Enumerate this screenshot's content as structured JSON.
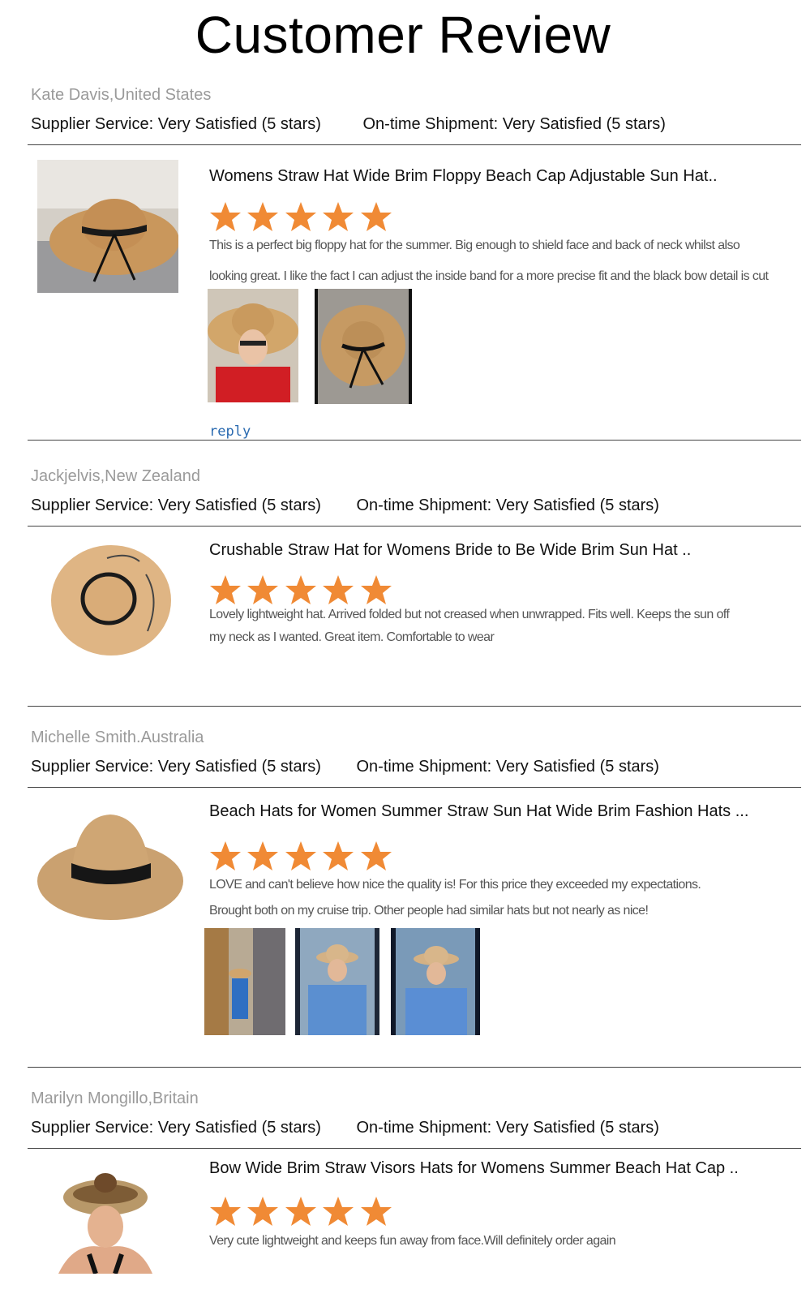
{
  "page": {
    "title": "Customer Review"
  },
  "colors": {
    "star": "#f08a35",
    "reviewer": "#9a9a9a",
    "link": "#2a6ab0"
  },
  "reviews": [
    {
      "reviewer": "Kate Davis,United States",
      "supplier_service": "Supplier Service: Very Satisfied (5 stars)",
      "shipment": "On-time Shipment: Very Satisfied (5 stars)",
      "product_title": "Womens Straw Hat Wide Brim Floppy Beach Cap Adjustable Sun Hat..",
      "rating": 5,
      "text": [
        "This is a perfect big floppy hat for the summer. Big enough to shield face and back of neck whilst also",
        "looking great. I like the fact I can adjust the inside band for a more precise fit and the black bow detail is cut"
      ],
      "reply_label": "reply"
    },
    {
      "reviewer": "Jackjelvis,New Zealand",
      "supplier_service": "Supplier Service: Very Satisfied (5 stars)",
      "shipment": "On-time Shipment: Very Satisfied (5 stars)",
      "product_title": "Crushable Straw Hat for Womens Bride to Be Wide Brim Sun Hat ..",
      "rating": 5,
      "text": [
        "Lovely lightweight hat. Arrived folded but not creased when unwrapped. Fits well. Keeps the sun off",
        "my neck as I wanted. Great item. Comfortable to wear"
      ]
    },
    {
      "reviewer": "Michelle Smith.Australia",
      "supplier_service": "Supplier Service: Very Satisfied (5 stars)",
      "shipment": "On-time Shipment: Very Satisfied (5 stars)",
      "product_title": "Beach Hats for Women Summer Straw Sun Hat Wide Brim Fashion Hats ...",
      "rating": 5,
      "text": [
        "LOVE and can't believe how nice the quality is! For this price they exceeded my expectations.",
        "Brought both on my cruise trip. Other people had similar hats but not nearly as nice!"
      ]
    },
    {
      "reviewer": "Marilyn Mongillo,Britain",
      "supplier_service": "Supplier Service: Very Satisfied (5 stars)",
      "shipment": "On-time Shipment: Very Satisfied (5 stars)",
      "product_title": "Bow Wide Brim Straw Visors Hats for Womens Summer Beach Hat Cap  ..",
      "rating": 5,
      "text": [
        "Very cute lightweight and keeps fun away from face.Will definitely order again"
      ]
    }
  ]
}
